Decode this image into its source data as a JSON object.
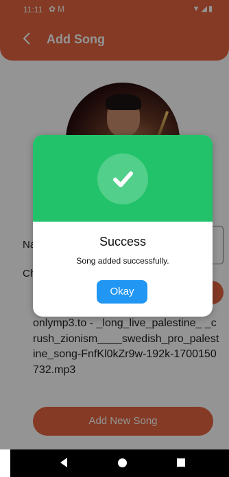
{
  "status_bar": {
    "time": "11:11",
    "left_icons": [
      "gear-icon",
      "mail-icon"
    ],
    "right_icons": [
      "wifi-icon",
      "signal-icon",
      "battery-icon"
    ]
  },
  "app_bar": {
    "title": "Add Song",
    "back_icon": "chevron-left-icon"
  },
  "form": {
    "name_label": "Na",
    "choose_label": "Ch",
    "file_name": "onlymp3.to - _long_live_palestine_ _crush_zionism____swedish_pro_palestine_song-FnfKl0kZr9w-192k-1700150732.mp3",
    "add_button_label": "Add New Song"
  },
  "dialog": {
    "icon": "check-icon",
    "title": "Success",
    "message": "Song added successfully.",
    "button_label": "Okay"
  },
  "colors": {
    "accent": "#e4643f",
    "success": "#22c26a",
    "button_blue": "#2196f3"
  }
}
